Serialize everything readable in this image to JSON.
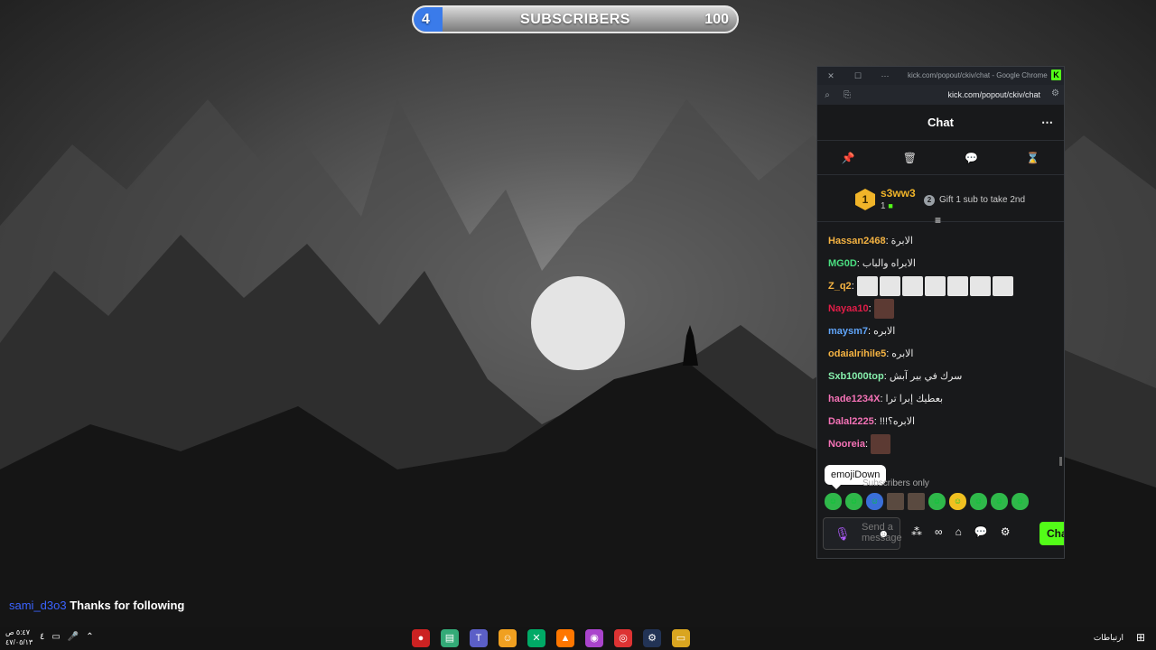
{
  "subscriber_bar": {
    "current": "4",
    "label": "SUBSCRIBERS",
    "goal": "100",
    "progress_fraction": 0.04,
    "fill_color": "#3a7bea"
  },
  "window": {
    "title": "kick.com/popout/ckiv/chat - Google Chrome",
    "url": "kick.com/popout/ckiv/chat",
    "logo": "K",
    "controls": {
      "close": "✕",
      "maximize": "☐",
      "more": "⋯"
    }
  },
  "chat": {
    "title": "Chat",
    "more_icon": "⋯",
    "mod_tools": [
      {
        "name": "pin-icon",
        "glyph": "📌"
      },
      {
        "name": "trash-icon",
        "glyph": "🗑"
      },
      {
        "name": "chat-bubble-icon",
        "glyph": "💬"
      },
      {
        "name": "hourglass-icon",
        "glyph": "⌛"
      }
    ],
    "leaderboard": {
      "rank": "1",
      "username": "s3ww3",
      "count": "1",
      "next_rank": "2",
      "hint": "Gift 1 sub to take 2nd",
      "collapse_icon": "≡"
    },
    "messages": [
      {
        "user": "Hassan2468",
        "color": "#f5b342",
        "text": "الابرة"
      },
      {
        "user": "MG0D",
        "color": "#4ade80",
        "text": "الابراه والباب"
      },
      {
        "user": "Z_q2",
        "color": "#f5b342",
        "text": "",
        "emotes": 7
      },
      {
        "user": "Nayaa10",
        "color": "#e11d48",
        "text": "",
        "face": true
      },
      {
        "user": "maysm7",
        "color": "#60a5fa",
        "text": "الابره"
      },
      {
        "user": "odaialrihile5",
        "color": "#f5b342",
        "text": "الابره"
      },
      {
        "user": "Sxb1000top",
        "color": "#86efac",
        "text": "سرك في بير آبش"
      },
      {
        "user": "hade1234X",
        "color": "#f472b6",
        "text": "بعطيك إبرا ترا"
      },
      {
        "user": "Dalal2225",
        "color": "#f472b6",
        "text": "!!!الابره؟"
      },
      {
        "user": "Nooreia",
        "color": "#f472b6",
        "text": "",
        "face": true
      }
    ],
    "tooltip": "emojiDown",
    "subscribers_only": "Subscribers only",
    "composer_placeholder": "Send a message",
    "send_button": "Chat"
  },
  "follow_alert": {
    "username": "sami_d3o3",
    "message": "Thanks for following"
  },
  "taskbar": {
    "time": "٥:٤٧ ص",
    "date": "٤٧/٠٥/١٣",
    "lang": "٤",
    "network_label": "ارتباطات",
    "apps": [
      "obs",
      "notepad",
      "teams",
      "discord",
      "xbox",
      "vlc",
      "messenger",
      "chrome",
      "steam",
      "files"
    ]
  }
}
